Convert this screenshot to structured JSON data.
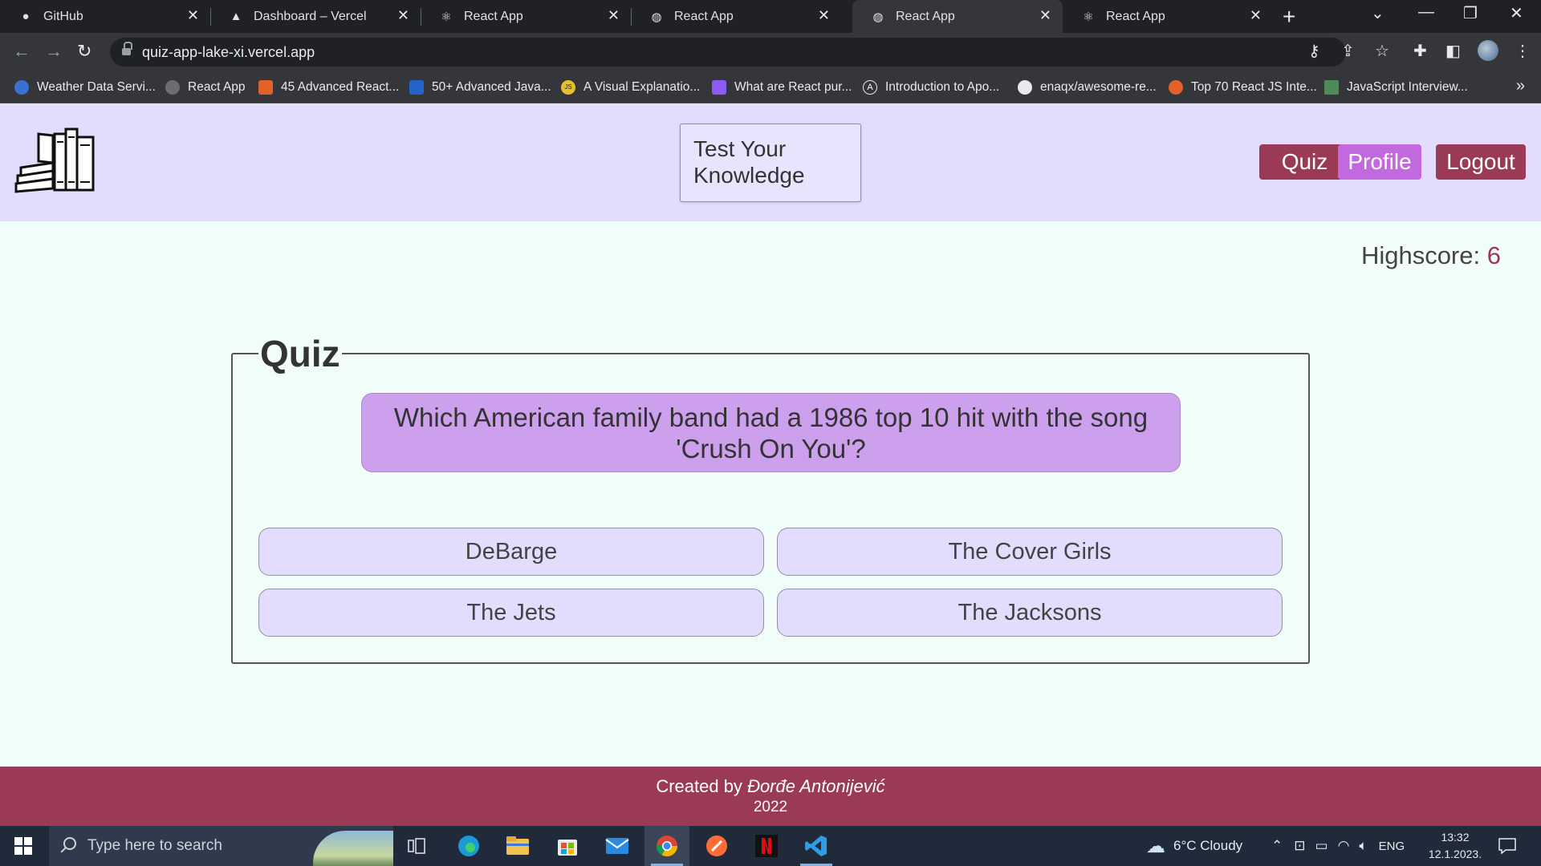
{
  "browser": {
    "tabs": [
      {
        "title": "GitHub",
        "icon": "github-icon"
      },
      {
        "title": "Dashboard – Vercel",
        "icon": "vercel-icon"
      },
      {
        "title": "React App",
        "icon": "react-icon"
      },
      {
        "title": "React App",
        "icon": "globe-icon"
      },
      {
        "title": "React App",
        "icon": "globe-icon",
        "active": true
      },
      {
        "title": "React App",
        "icon": "react-icon"
      }
    ],
    "url": "quiz-app-lake-xi.vercel.app",
    "bookmarks": [
      {
        "label": "Weather Data Servi...",
        "color": "#3b6fd4"
      },
      {
        "label": "React App",
        "color": "#6b6d72"
      },
      {
        "label": "45 Advanced React...",
        "color": "#e2622a"
      },
      {
        "label": "50+ Advanced Java...",
        "color": "#2563c9"
      },
      {
        "label": "A Visual Explanatio...",
        "color": "#e5c02b"
      },
      {
        "label": "What are React pur...",
        "color": "#8b5cf6"
      },
      {
        "label": "Introduction to Apo...",
        "color": "#444"
      },
      {
        "label": "enaqx/awesome-re...",
        "color": "#444"
      },
      {
        "label": "Top 70 React JS Inte...",
        "color": "#e2622a"
      },
      {
        "label": "JavaScript Interview...",
        "color": "#4f8a5b"
      }
    ]
  },
  "header": {
    "brand": "Test Your Knowledge",
    "nav": {
      "quiz": "Quiz",
      "profile": "Profile",
      "logout": "Logout"
    }
  },
  "highscore": {
    "label": "Highscore:",
    "value": "6"
  },
  "quiz": {
    "legend": "Quiz",
    "question": "Which American family band had a 1986 top 10 hit with the song 'Crush On You'?",
    "answers": [
      "DeBarge",
      "The Cover Girls",
      "The Jets",
      "The Jacksons"
    ]
  },
  "footer": {
    "prefix": "Created by",
    "author": "Đorđe Antonijević",
    "year": "2022"
  },
  "taskbar": {
    "search_placeholder": "Type here to search",
    "weather": "6°C  Cloudy",
    "language": "ENG",
    "time": "13:32",
    "date": "12.1.2023."
  },
  "colors": {
    "accent": "#9a3a55",
    "header_bg": "#e4dcfd",
    "question_bg": "#cda0ee",
    "profile_btn": "#c369e0",
    "page_bg": "#f1fdf9"
  }
}
